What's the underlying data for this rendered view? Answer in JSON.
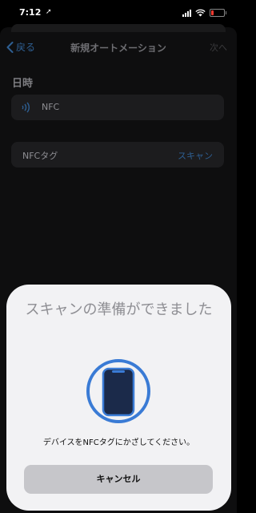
{
  "status_bar": {
    "time": "7:12",
    "location_glyph": "➚",
    "battery_color": "#ff3b30"
  },
  "navbar": {
    "back_label": "戻る",
    "title": "新規オートメーション",
    "next_label": "次へ"
  },
  "section": {
    "label": "日時"
  },
  "trigger": {
    "icon": "nfc-icon",
    "label": "NFC"
  },
  "tag_row": {
    "label": "NFCタグ",
    "action": "スキャン"
  },
  "modal": {
    "title": "スキャンの準備ができました",
    "icon": "phone-icon",
    "instruction": "デバイスをNFCタグにかざしてください。",
    "cancel_label": "キャンセル"
  },
  "colors": {
    "accent": "#2e5f92",
    "ring": "#3a7bd5"
  }
}
